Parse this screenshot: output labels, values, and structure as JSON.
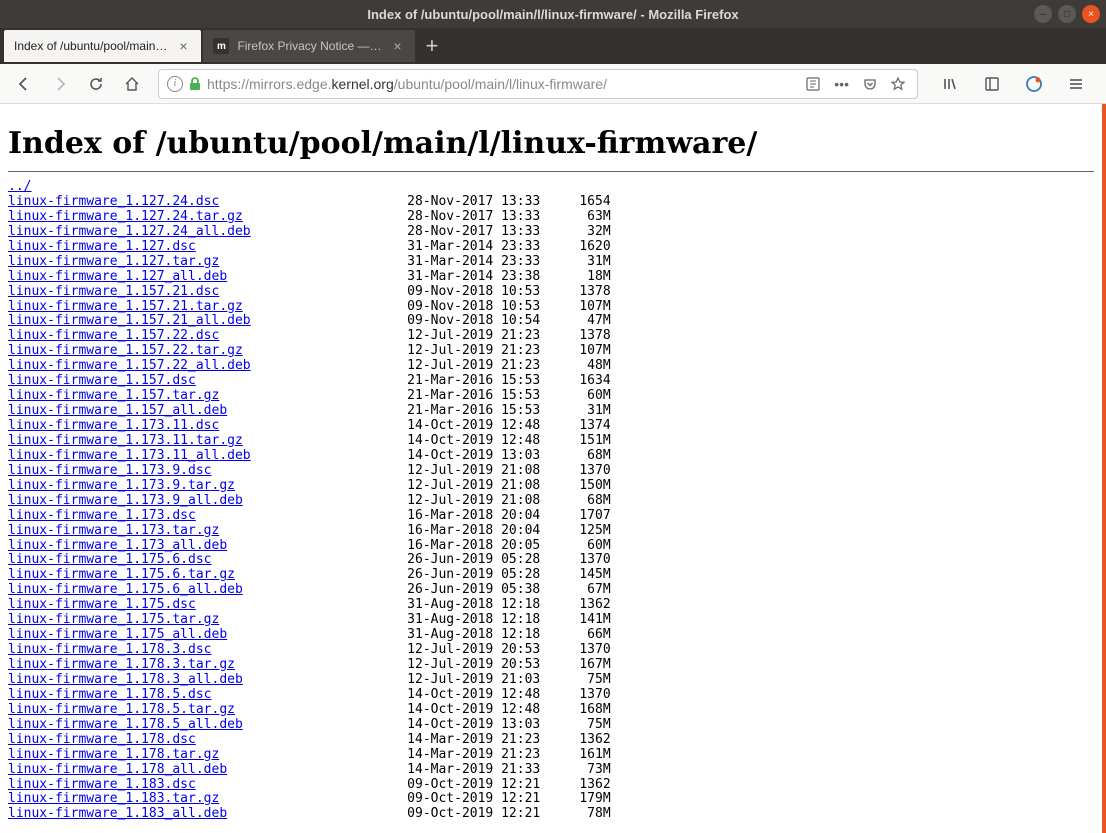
{
  "window": {
    "title": "Index of /ubuntu/pool/main/l/linux-firmware/ - Mozilla Firefox"
  },
  "tabs": [
    {
      "label": "Index of /ubuntu/pool/main…",
      "active": true
    },
    {
      "label": "Firefox Privacy Notice —…",
      "active": false
    }
  ],
  "url": {
    "prefix": "https://mirrors.edge.",
    "domain": "kernel.org",
    "path": "/ubuntu/pool/main/l/linux-firmware/"
  },
  "page": {
    "heading": "Index of /ubuntu/pool/main/l/linux-firmware/",
    "parent_link": "../",
    "files": [
      {
        "name": "linux-firmware_1.127.24.dsc",
        "date": "28-Nov-2017 13:33",
        "size": "1654"
      },
      {
        "name": "linux-firmware_1.127.24.tar.gz",
        "date": "28-Nov-2017 13:33",
        "size": "63M"
      },
      {
        "name": "linux-firmware_1.127.24_all.deb",
        "date": "28-Nov-2017 13:33",
        "size": "32M"
      },
      {
        "name": "linux-firmware_1.127.dsc",
        "date": "31-Mar-2014 23:33",
        "size": "1620"
      },
      {
        "name": "linux-firmware_1.127.tar.gz",
        "date": "31-Mar-2014 23:33",
        "size": "31M"
      },
      {
        "name": "linux-firmware_1.127_all.deb",
        "date": "31-Mar-2014 23:38",
        "size": "18M"
      },
      {
        "name": "linux-firmware_1.157.21.dsc",
        "date": "09-Nov-2018 10:53",
        "size": "1378"
      },
      {
        "name": "linux-firmware_1.157.21.tar.gz",
        "date": "09-Nov-2018 10:53",
        "size": "107M"
      },
      {
        "name": "linux-firmware_1.157.21_all.deb",
        "date": "09-Nov-2018 10:54",
        "size": "47M"
      },
      {
        "name": "linux-firmware_1.157.22.dsc",
        "date": "12-Jul-2019 21:23",
        "size": "1378"
      },
      {
        "name": "linux-firmware_1.157.22.tar.gz",
        "date": "12-Jul-2019 21:23",
        "size": "107M"
      },
      {
        "name": "linux-firmware_1.157.22_all.deb",
        "date": "12-Jul-2019 21:23",
        "size": "48M"
      },
      {
        "name": "linux-firmware_1.157.dsc",
        "date": "21-Mar-2016 15:53",
        "size": "1634"
      },
      {
        "name": "linux-firmware_1.157.tar.gz",
        "date": "21-Mar-2016 15:53",
        "size": "60M"
      },
      {
        "name": "linux-firmware_1.157_all.deb",
        "date": "21-Mar-2016 15:53",
        "size": "31M"
      },
      {
        "name": "linux-firmware_1.173.11.dsc",
        "date": "14-Oct-2019 12:48",
        "size": "1374"
      },
      {
        "name": "linux-firmware_1.173.11.tar.gz",
        "date": "14-Oct-2019 12:48",
        "size": "151M"
      },
      {
        "name": "linux-firmware_1.173.11_all.deb",
        "date": "14-Oct-2019 13:03",
        "size": "68M"
      },
      {
        "name": "linux-firmware_1.173.9.dsc",
        "date": "12-Jul-2019 21:08",
        "size": "1370"
      },
      {
        "name": "linux-firmware_1.173.9.tar.gz",
        "date": "12-Jul-2019 21:08",
        "size": "150M"
      },
      {
        "name": "linux-firmware_1.173.9_all.deb",
        "date": "12-Jul-2019 21:08",
        "size": "68M"
      },
      {
        "name": "linux-firmware_1.173.dsc",
        "date": "16-Mar-2018 20:04",
        "size": "1707"
      },
      {
        "name": "linux-firmware_1.173.tar.gz",
        "date": "16-Mar-2018 20:04",
        "size": "125M"
      },
      {
        "name": "linux-firmware_1.173_all.deb",
        "date": "16-Mar-2018 20:05",
        "size": "60M"
      },
      {
        "name": "linux-firmware_1.175.6.dsc",
        "date": "26-Jun-2019 05:28",
        "size": "1370"
      },
      {
        "name": "linux-firmware_1.175.6.tar.gz",
        "date": "26-Jun-2019 05:28",
        "size": "145M"
      },
      {
        "name": "linux-firmware_1.175.6_all.deb",
        "date": "26-Jun-2019 05:38",
        "size": "67M"
      },
      {
        "name": "linux-firmware_1.175.dsc",
        "date": "31-Aug-2018 12:18",
        "size": "1362"
      },
      {
        "name": "linux-firmware_1.175.tar.gz",
        "date": "31-Aug-2018 12:18",
        "size": "141M"
      },
      {
        "name": "linux-firmware_1.175_all.deb",
        "date": "31-Aug-2018 12:18",
        "size": "66M"
      },
      {
        "name": "linux-firmware_1.178.3.dsc",
        "date": "12-Jul-2019 20:53",
        "size": "1370"
      },
      {
        "name": "linux-firmware_1.178.3.tar.gz",
        "date": "12-Jul-2019 20:53",
        "size": "167M"
      },
      {
        "name": "linux-firmware_1.178.3_all.deb",
        "date": "12-Jul-2019 21:03",
        "size": "75M"
      },
      {
        "name": "linux-firmware_1.178.5.dsc",
        "date": "14-Oct-2019 12:48",
        "size": "1370"
      },
      {
        "name": "linux-firmware_1.178.5.tar.gz",
        "date": "14-Oct-2019 12:48",
        "size": "168M"
      },
      {
        "name": "linux-firmware_1.178.5_all.deb",
        "date": "14-Oct-2019 13:03",
        "size": "75M"
      },
      {
        "name": "linux-firmware_1.178.dsc",
        "date": "14-Mar-2019 21:23",
        "size": "1362"
      },
      {
        "name": "linux-firmware_1.178.tar.gz",
        "date": "14-Mar-2019 21:23",
        "size": "161M"
      },
      {
        "name": "linux-firmware_1.178_all.deb",
        "date": "14-Mar-2019 21:33",
        "size": "73M"
      },
      {
        "name": "linux-firmware_1.183.dsc",
        "date": "09-Oct-2019 12:21",
        "size": "1362"
      },
      {
        "name": "linux-firmware_1.183.tar.gz",
        "date": "09-Oct-2019 12:21",
        "size": "179M"
      },
      {
        "name": "linux-firmware_1.183_all.deb",
        "date": "09-Oct-2019 12:21",
        "size": "78M"
      }
    ]
  }
}
